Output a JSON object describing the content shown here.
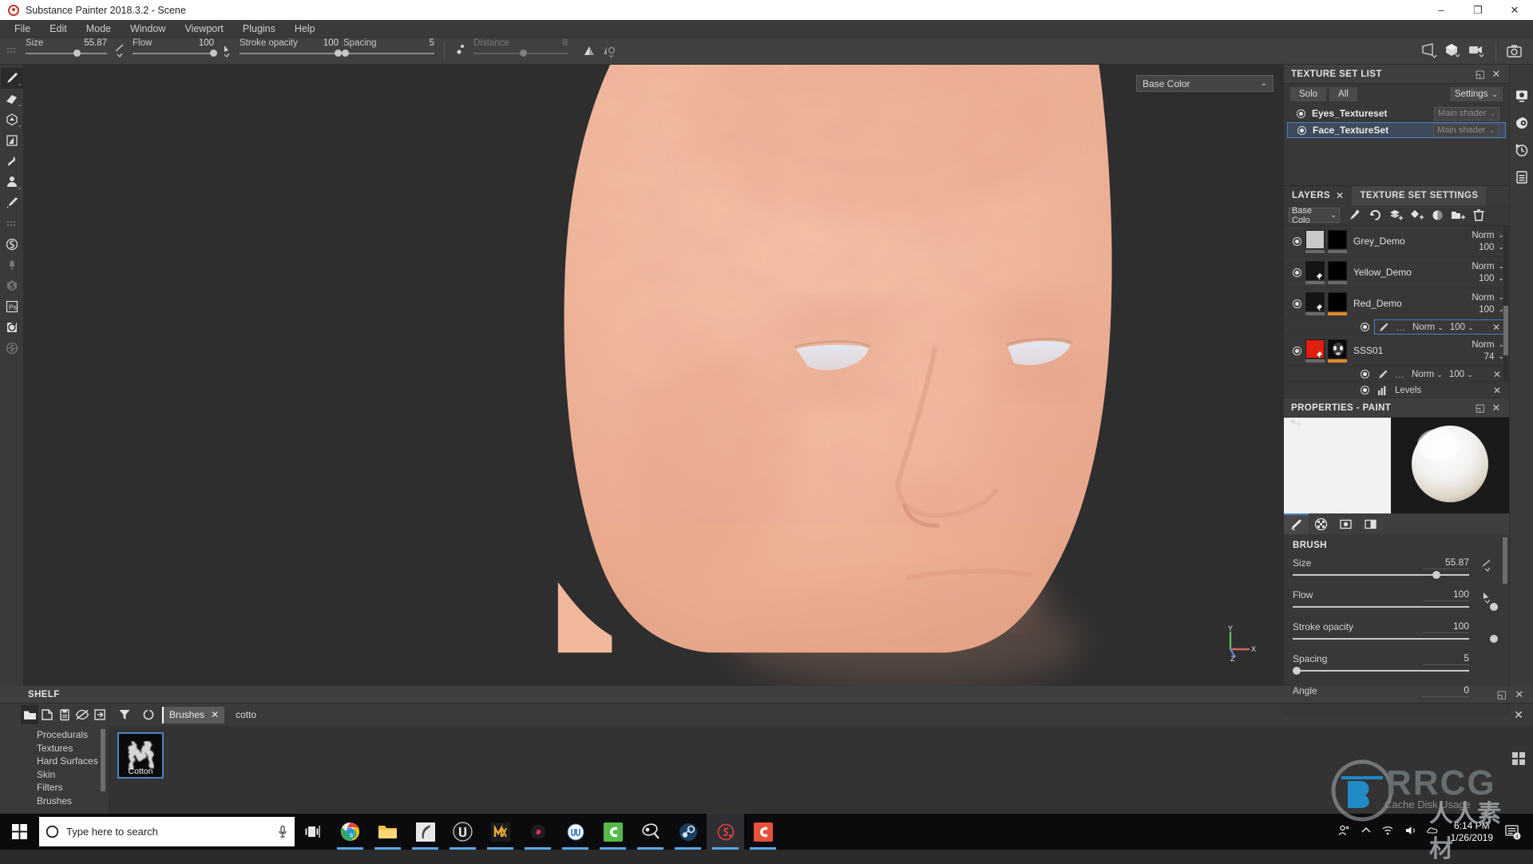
{
  "titlebar": {
    "title": "Substance Painter 2018.3.2 - Scene",
    "minimize": "–",
    "maximize": "❐",
    "close": "✕"
  },
  "menubar": {
    "items": [
      "File",
      "Edit",
      "Mode",
      "Window",
      "Viewport",
      "Plugins",
      "Help"
    ]
  },
  "toolbar": {
    "params": [
      {
        "label": "Size",
        "value": "55.87",
        "pct": 60,
        "dim": false
      },
      {
        "label": "Flow",
        "value": "100",
        "pct": 100,
        "dim": false
      },
      {
        "label": "Stroke opacity",
        "value": "100",
        "pct": 100,
        "dim": false
      },
      {
        "label": "Spacing",
        "value": "5",
        "pct": 2,
        "dim": false
      },
      {
        "label": "Distance",
        "value": "8",
        "pct": 50,
        "dim": true
      }
    ],
    "viewport_icons": [
      "perspective-camera-icon",
      "shading-cube-icon",
      "camera-view-icon",
      "screenshot-icon"
    ]
  },
  "left_tools": [
    {
      "name": "paint-brush-tool",
      "active": true,
      "dim": false,
      "chevron": true
    },
    {
      "name": "eraser-tool",
      "active": false,
      "dim": false,
      "chevron": true
    },
    {
      "name": "projection-tool",
      "active": false,
      "dim": false,
      "chevron": true
    },
    {
      "name": "polygon-fill-tool",
      "active": false,
      "dim": false,
      "chevron": false
    },
    {
      "name": "smudge-tool",
      "active": false,
      "dim": false,
      "chevron": false
    },
    {
      "name": "clone-stamp-tool",
      "active": false,
      "dim": false,
      "chevron": true
    },
    {
      "name": "color-picker-tool",
      "active": false,
      "dim": false,
      "chevron": false
    },
    {
      "name": "drag-handle-dots",
      "active": false,
      "dim": true,
      "chevron": false
    },
    {
      "name": "material-preset-tool",
      "active": false,
      "dim": false,
      "chevron": false
    },
    {
      "name": "particle-tool",
      "active": false,
      "dim": true,
      "chevron": false
    },
    {
      "name": "substance-material-tool",
      "active": false,
      "dim": true,
      "chevron": false
    },
    {
      "name": "photoshop-bridge-tool",
      "active": false,
      "dim": false,
      "chevron": false
    },
    {
      "name": "bake-tool",
      "active": false,
      "dim": false,
      "chevron": false
    },
    {
      "name": "substance-source-tool",
      "active": false,
      "dim": true,
      "chevron": false
    }
  ],
  "viewport": {
    "channel_selector": "Base Color",
    "gizmo_axes": [
      "X",
      "Y",
      "Z"
    ]
  },
  "right_rail": [
    {
      "name": "display-settings-icon"
    },
    {
      "name": "shader-settings-icon"
    },
    {
      "name": "history-icon"
    },
    {
      "name": "log-icon"
    }
  ],
  "texture_set_list": {
    "title": "TEXTURE SET LIST",
    "dock_icon": "◱",
    "close_icon": "✕",
    "solo_label": "Solo",
    "all_label": "All",
    "settings_label": "Settings",
    "rows": [
      {
        "name": "Eyes_Textureset",
        "shader": "Main shader",
        "selected": false
      },
      {
        "name": "Face_TextureSet",
        "shader": "Main shader",
        "selected": true
      }
    ]
  },
  "layers_panel": {
    "tab_layers": "LAYERS",
    "tab_texture_set_settings": "TEXTURE SET SETTINGS",
    "close_icon": "✕",
    "channel_dropdown": "Base Colo",
    "toolbar_icons": [
      "smart-material-icon",
      "smart-mask-icon",
      "add-fill-layer-icon",
      "add-paint-layer-icon",
      "add-mask-icon",
      "add-folder-icon",
      "delete-layer-icon"
    ],
    "layers": [
      {
        "name": "Grey_Demo",
        "blend": "Norm",
        "opacity": "100",
        "thumb_color": "#c9c9c9",
        "mask_color": "#000000",
        "strip": "#6a6a6a",
        "mask_strip": "#6a6a6a",
        "has_fx_badge": false
      },
      {
        "name": "Yellow_Demo",
        "blend": "Norm",
        "opacity": "100",
        "thumb_color": "#141414",
        "mask_color": "#000000",
        "strip": "#6a6a6a",
        "mask_strip": "#6a6a6a",
        "has_fx_badge": true
      },
      {
        "name": "Red_Demo",
        "blend": "Norm",
        "opacity": "100",
        "thumb_color": "#141414",
        "mask_color": "#000000",
        "strip": "#6a6a6a",
        "mask_strip": "#e08a26",
        "has_fx_badge": true
      }
    ],
    "red_demo_effect": {
      "dots": "…",
      "blend": "Norm",
      "opacity": "100",
      "close": "✕",
      "selected": true
    },
    "sss_layer": {
      "name": "SSS01",
      "blend": "Norm",
      "opacity": "74",
      "thumb_color": "#e01e0e",
      "strip": "#6a6a6a",
      "mask_strip": "#e08a26"
    },
    "sss_effects": [
      {
        "icon": "paint-effect-icon",
        "dots": "…",
        "blend": "Norm",
        "opacity": "100",
        "close": "✕"
      },
      {
        "icon": "levels-icon",
        "label": "Levels",
        "close": "✕"
      }
    ]
  },
  "properties_panel": {
    "title": "PROPERTIES - PAINT",
    "dock_icon": "◱",
    "close_icon": "✕",
    "tabs": [
      "brush-tab-icon",
      "alpha-tab-icon",
      "stencil-tab-icon",
      "material-tab-icon"
    ],
    "section_title": "BRUSH",
    "props": [
      {
        "label": "Size",
        "value": "55.87",
        "pct": 73,
        "jitter": "size-jitter-icon"
      },
      {
        "label": "Flow",
        "value": "100",
        "pct": 100,
        "jitter": "flow-jitter-icon"
      },
      {
        "label": "Stroke opacity",
        "value": "100",
        "pct": 100,
        "jitter": ""
      },
      {
        "label": "Spacing",
        "value": "5",
        "pct": 2,
        "jitter": ""
      },
      {
        "label": "Angle",
        "value": "0",
        "pct": 0,
        "jitter": ""
      }
    ]
  },
  "shelf": {
    "title": "SHELF",
    "dock_icon": "◱",
    "close_icon": "✕",
    "left_tools": [
      "folder-icon",
      "new-document-icon",
      "save-icon",
      "hide-icon",
      "import-icon"
    ],
    "categories": [
      "Procedurals",
      "Textures",
      "Hard Surfaces",
      "Skin",
      "Filters",
      "Brushes"
    ],
    "filter_icon": "filter-icon",
    "refresh_icon": "refresh-icon",
    "filter_chip": "Brushes",
    "filter_chip_close": "✕",
    "search_value": "cotto",
    "search_clear": "✕",
    "grid_toggle": "grid-view-icon",
    "assets": [
      {
        "name": "Cotton"
      }
    ]
  },
  "taskbar": {
    "start_icon": "windows-start-icon",
    "search_placeholder": "Type here to search",
    "cortana_icon": "cortana-circle-icon",
    "mic_icon": "microphone-icon",
    "taskview_icon": "task-view-icon",
    "apps": [
      {
        "name": "chrome-icon",
        "active": false,
        "running": true
      },
      {
        "name": "file-explorer-icon",
        "active": false,
        "running": true
      },
      {
        "name": "zbrush-icon",
        "active": false,
        "running": true
      },
      {
        "name": "unreal-engine-icon",
        "active": false,
        "running": true
      },
      {
        "name": "marmoset-icon",
        "active": false,
        "running": true
      },
      {
        "name": "quixel-icon",
        "active": false,
        "running": true
      },
      {
        "name": "wacom-icon",
        "active": false,
        "running": true
      },
      {
        "name": "camtasia-icon",
        "active": false,
        "running": true
      },
      {
        "name": "keyshot-icon",
        "active": false,
        "running": true
      },
      {
        "name": "steam-icon",
        "active": false,
        "running": true
      },
      {
        "name": "substance-painter-icon",
        "active": true,
        "running": true
      },
      {
        "name": "camtasia-studio-icon",
        "active": false,
        "running": true
      }
    ],
    "tray_icons": [
      "people-icon",
      "show-hidden-icons-chevron",
      "network-icon",
      "volume-icon",
      "onedrive-icon"
    ],
    "time": "6:14 PM",
    "date": "1/26/2019",
    "notification_count": "4"
  },
  "watermark": {
    "text": "RRCG",
    "sub": "Cache Disk Usage",
    "cn": "人人素材"
  },
  "colors": {
    "accent_blue": "#4a82c8",
    "orange_strip": "#e08a26",
    "panel_bg": "#383838",
    "toolbar_bg": "#404040",
    "viewport_bg": "#2e2e2e",
    "skin_base": "#f0b79a"
  }
}
